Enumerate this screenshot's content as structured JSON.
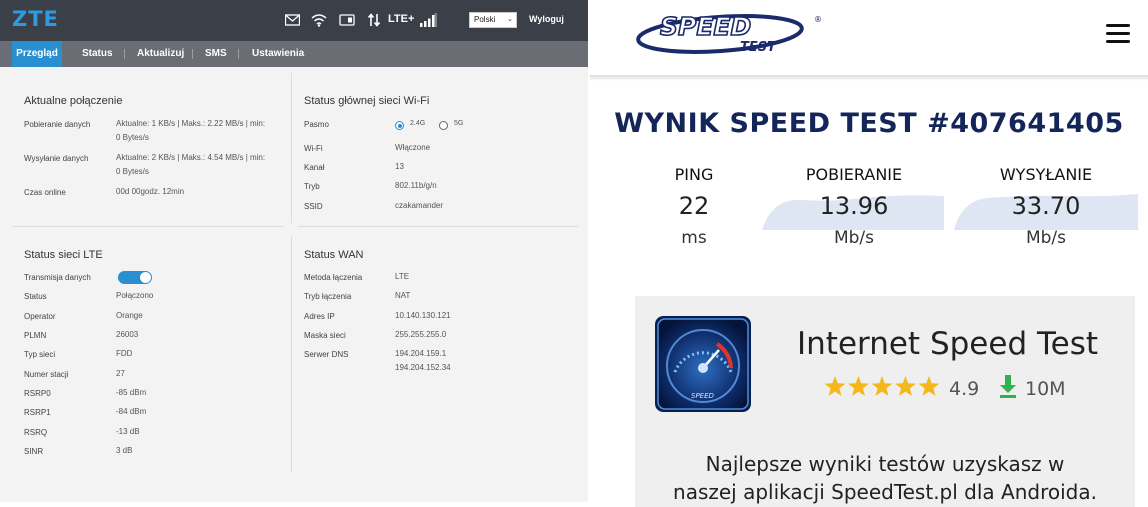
{
  "router": {
    "logo": "ZTE",
    "topbar": {
      "icons": [
        "mail-icon",
        "wifi-icon",
        "sim-icon",
        "data-transfer-icon",
        "signal-strength-icon"
      ],
      "network_type": "LTE+",
      "language": "Polski",
      "logout_label": "Wyloguj"
    },
    "nav": {
      "tabs": [
        {
          "label": "Przegląd",
          "active": true
        },
        {
          "label": "Status",
          "active": false
        },
        {
          "label": "Aktualizuj",
          "active": false
        },
        {
          "label": "SMS",
          "active": false
        },
        {
          "label": "Ustawienia",
          "active": false
        }
      ]
    },
    "current_connection": {
      "title": "Aktualne połączenie",
      "rows": [
        {
          "label": "Pobieranie danych",
          "value_line1": "Aktualne: 1 KB/s | Maks.: 2.22 MB/s | min:",
          "value_line2": "0 Bytes/s"
        },
        {
          "label": "Wysyłanie danych",
          "value_line1": "Aktualne: 2 KB/s | Maks.: 4.54 MB/s | min:",
          "value_line2": "0 Bytes/s"
        },
        {
          "label": "Czas online",
          "value_line1": "00d 00godz. 12min",
          "value_line2": ""
        }
      ]
    },
    "wifi_status": {
      "title": "Status głównej sieci Wi-Fi",
      "band_label": "Pasmo",
      "band_options": [
        "2.4G",
        "5G"
      ],
      "band_selected": "2.4G",
      "rows": [
        {
          "label": "Wi-Fi",
          "value": "Włączone"
        },
        {
          "label": "Kanał",
          "value": "13"
        },
        {
          "label": "Tryb",
          "value": "802.11b/g/n"
        },
        {
          "label": "SSID",
          "value": "czakamander"
        }
      ]
    },
    "lte_status": {
      "title": "Status sieci LTE",
      "toggle_label": "Transmisja danych",
      "toggle_on": true,
      "rows": [
        {
          "label": "Status",
          "value": "Połączono"
        },
        {
          "label": "Operator",
          "value": "Orange"
        },
        {
          "label": "PLMN",
          "value": "26003"
        },
        {
          "label": "Typ sieci",
          "value": "FDD"
        },
        {
          "label": "Numer stacji",
          "value": "27"
        },
        {
          "label": "RSRP0",
          "value": "-85 dBm"
        },
        {
          "label": "RSRP1",
          "value": "-84 dBm"
        },
        {
          "label": "RSRQ",
          "value": "-13 dB"
        },
        {
          "label": "SINR",
          "value": "3 dB"
        }
      ]
    },
    "wan_status": {
      "title": "Status WAN",
      "rows": [
        {
          "label": "Metoda łączenia",
          "value": "LTE"
        },
        {
          "label": "Tryb łączenia",
          "value": "NAT"
        },
        {
          "label": "Adres IP",
          "value": "10.140.130.121"
        },
        {
          "label": "Maska sieci",
          "value": "255.255.255.0"
        },
        {
          "label": "Serwer DNS",
          "value": "194.204.159.1",
          "value2": "194.204.152.34"
        }
      ]
    }
  },
  "speedtest": {
    "logo_main": "SPEED",
    "logo_sub": "TEST",
    "logo_mark": "®",
    "result_title": "WYNIK SPEED TEST #407641405",
    "metrics": [
      {
        "label": "PING",
        "value": "22",
        "unit": "ms"
      },
      {
        "label": "POBIERANIE",
        "value": "13.96",
        "unit": "Mb/s"
      },
      {
        "label": "WYSYŁANIE",
        "value": "33.70",
        "unit": "Mb/s"
      }
    ],
    "app": {
      "name": "Internet Speed Test",
      "rating": "4.9",
      "stars": 5,
      "downloads": "10M",
      "promo_line1": "Najlepsze wyniki testów uzyskasz w",
      "promo_line2": "naszej aplikacji SpeedTest.pl dla Androida."
    },
    "colors": {
      "title": "#14255a",
      "logo": "#1b2a6b",
      "star": "#f5b81c",
      "download_arrow": "#2fb24a",
      "wave": "#dfe6f3"
    }
  }
}
